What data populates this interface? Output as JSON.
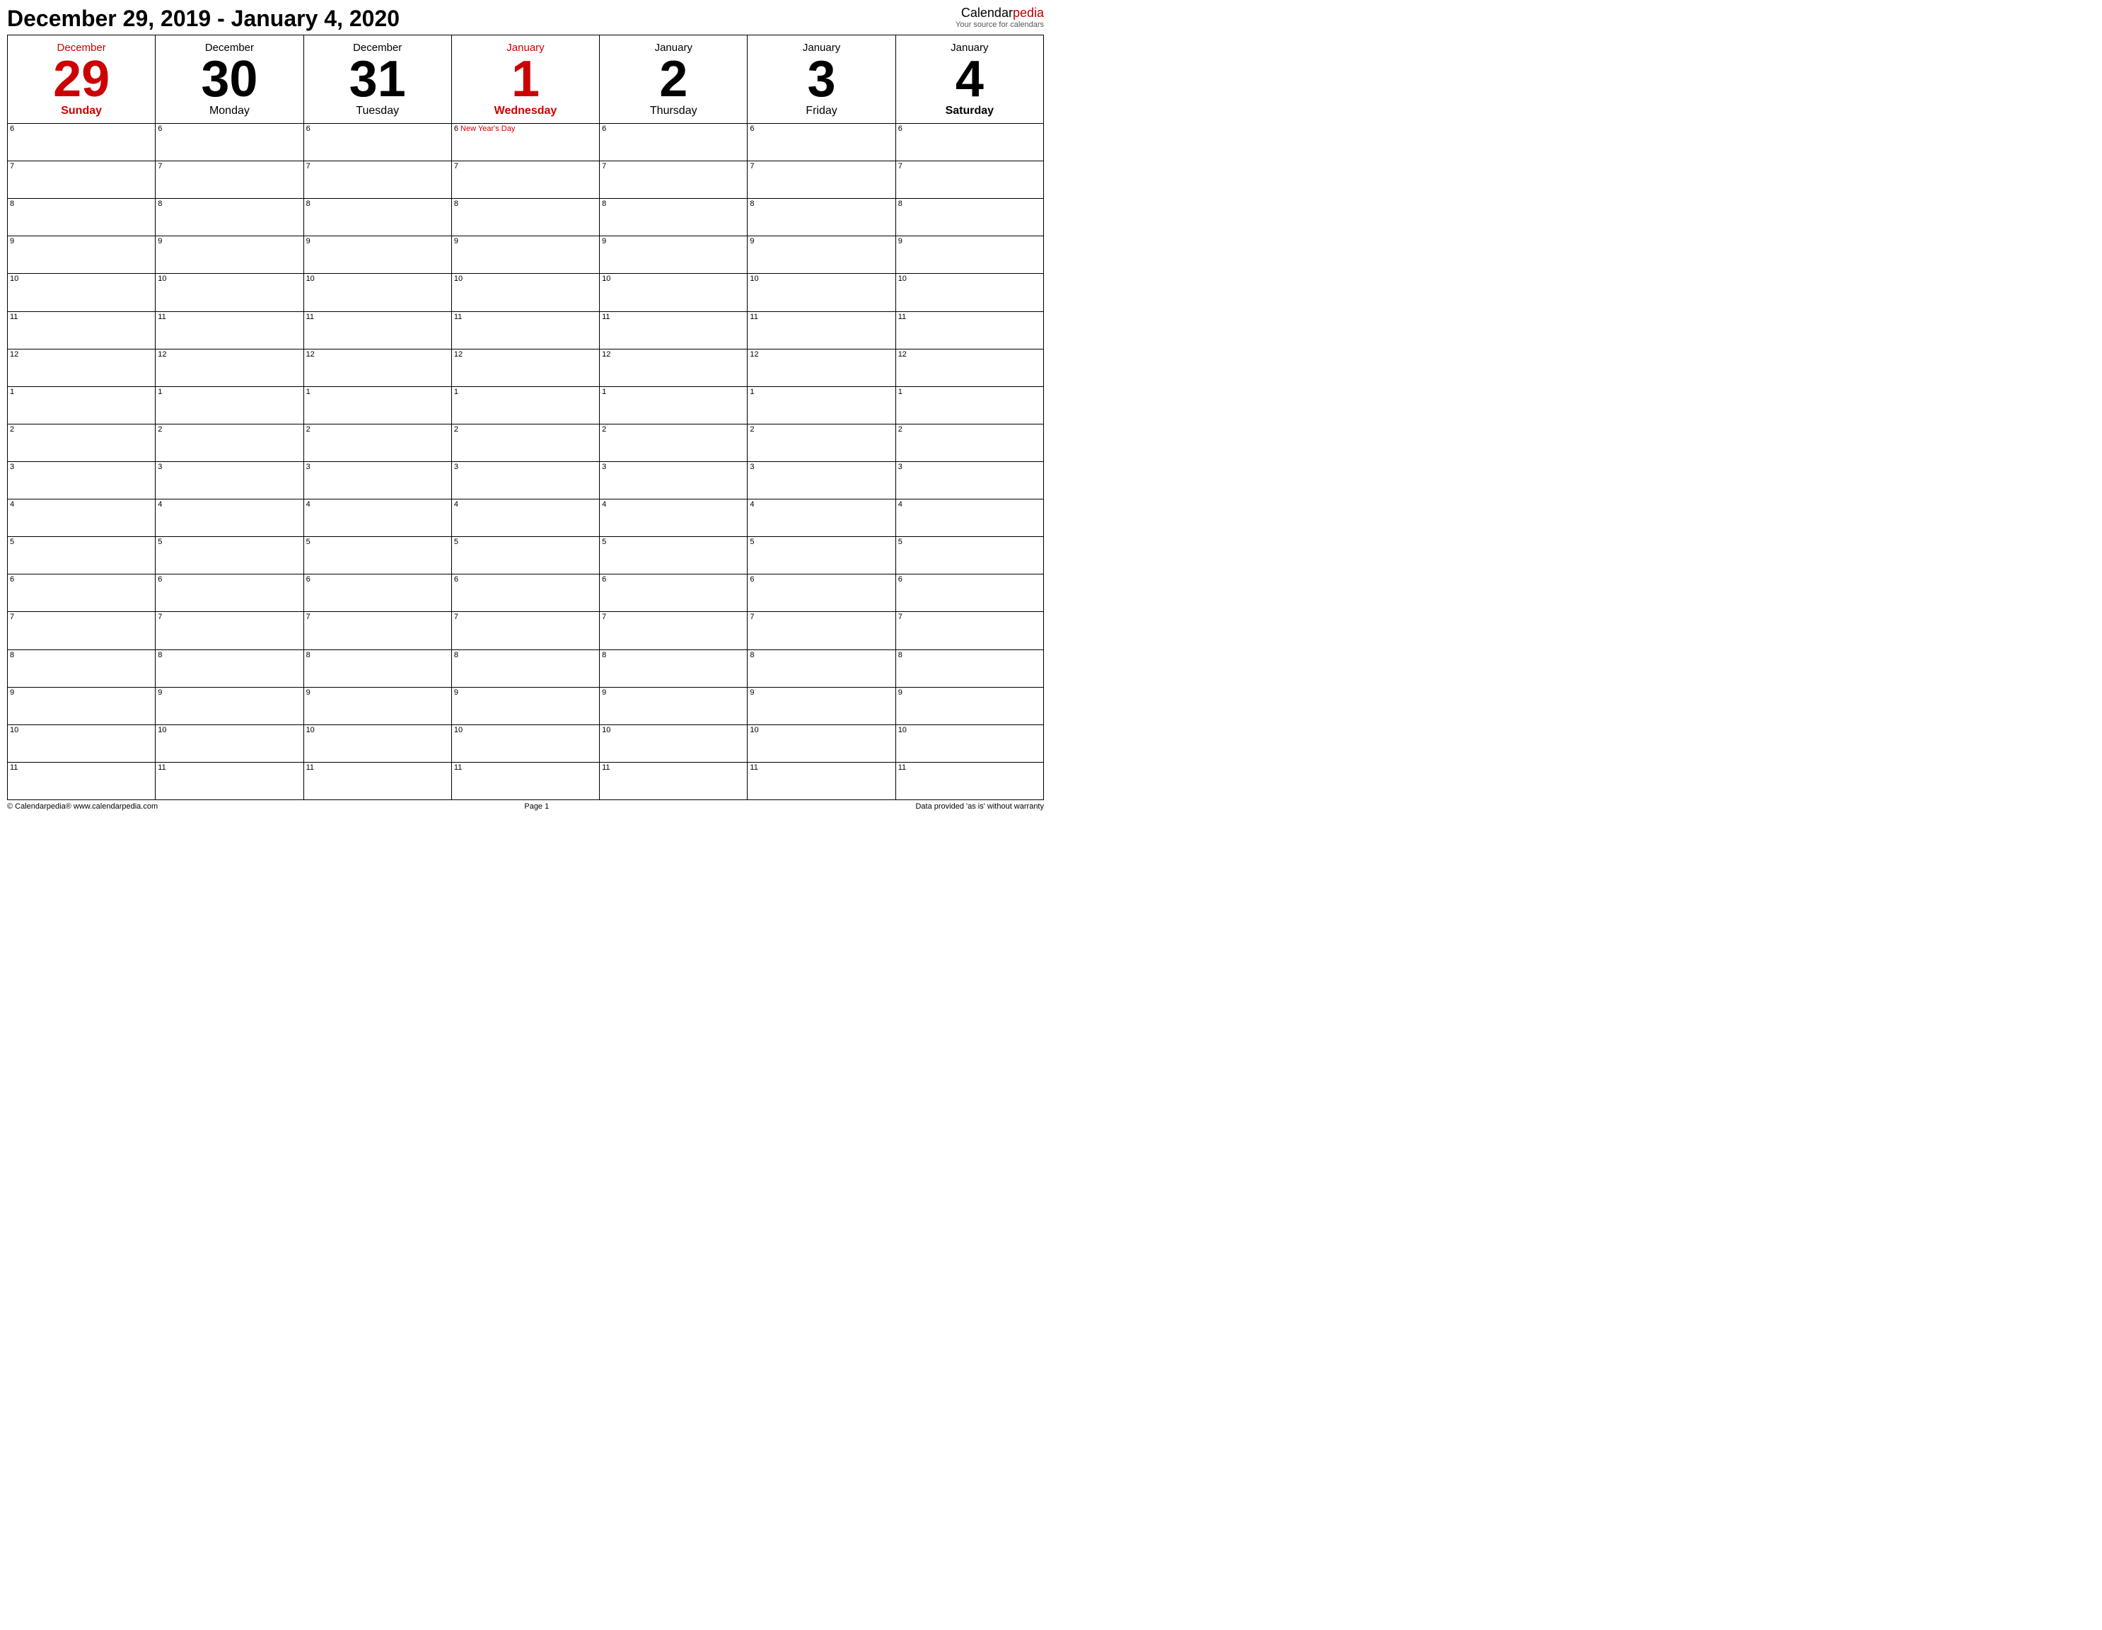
{
  "header": {
    "title": "December 29, 2019 - January 4, 2020",
    "logo_name": "Calendar",
    "logo_pedia": "pedia",
    "logo_subtitle": "Your source for calendars"
  },
  "days": [
    {
      "month": "December",
      "number": "29",
      "dayname": "Sunday",
      "highlight": true,
      "dayname_bold": true
    },
    {
      "month": "December",
      "number": "30",
      "dayname": "Monday",
      "highlight": false,
      "dayname_bold": false
    },
    {
      "month": "December",
      "number": "31",
      "dayname": "Tuesday",
      "highlight": false,
      "dayname_bold": false
    },
    {
      "month": "January",
      "number": "1",
      "dayname": "Wednesday",
      "highlight": true,
      "dayname_bold": true
    },
    {
      "month": "January",
      "number": "2",
      "dayname": "Thursday",
      "highlight": false,
      "dayname_bold": false
    },
    {
      "month": "January",
      "number": "3",
      "dayname": "Friday",
      "highlight": false,
      "dayname_bold": false
    },
    {
      "month": "January",
      "number": "4",
      "dayname": "Saturday",
      "highlight": false,
      "dayname_bold": true
    }
  ],
  "time_slots": [
    "6",
    "7",
    "8",
    "9",
    "10",
    "11",
    "12",
    "1",
    "2",
    "3",
    "4",
    "5",
    "6",
    "7",
    "8",
    "9",
    "10",
    "11"
  ],
  "events": {
    "3_0": "New Year's Day"
  },
  "footer": {
    "left": "© Calendarpedia®   www.calendarpedia.com",
    "center": "Page 1",
    "right": "Data provided 'as is' without warranty"
  }
}
